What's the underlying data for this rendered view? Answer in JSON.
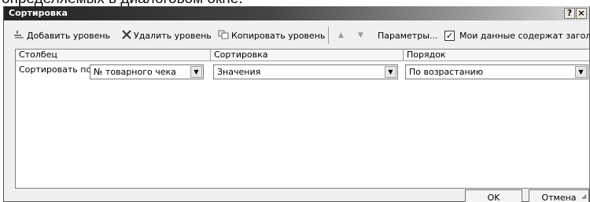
{
  "page_top_text": "определяемых в диалоговом окне.",
  "window": {
    "title": "Сортировка",
    "help_label": "?",
    "close_label": "×"
  },
  "toolbar": {
    "add_level": "Добавить уровень",
    "delete_level": "Удалить уровень",
    "copy_level": "Копировать уровень",
    "up_arrow": "▲",
    "down_arrow": "▼",
    "options": "Параметры...",
    "headers_checkbox": {
      "label": "Мои данные содержат заголовки",
      "checked": true,
      "mark": "✓"
    }
  },
  "columns": [
    "Столбец",
    "Сортировка",
    "Порядок"
  ],
  "rows": [
    {
      "label": "Сортировать по",
      "column": "№ товарного чека",
      "sort_on": "Значения",
      "order": "По возрастанию"
    }
  ],
  "footer": {
    "ok": "OK",
    "cancel": "Отмена"
  },
  "icons": {
    "add": "add-level-icon",
    "delete": "delete-icon",
    "copy": "copy-icon",
    "dropdown": "chevron-down-icon"
  }
}
